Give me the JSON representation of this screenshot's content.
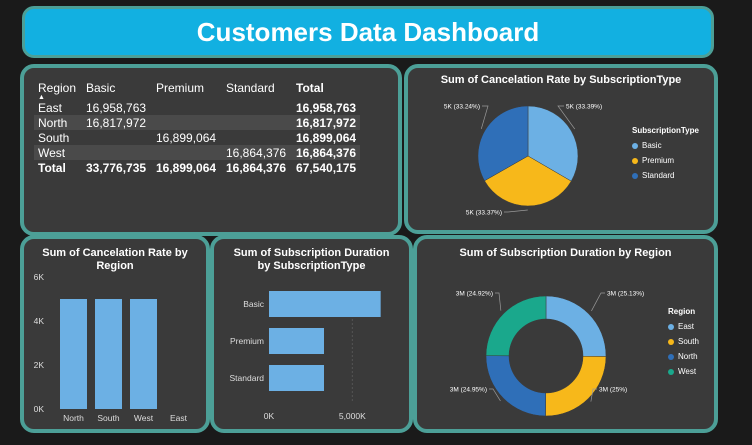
{
  "title": "Customers Data Dashboard",
  "colors": {
    "teal_border": "#4c9f97",
    "banner": "#12b0e1",
    "basic": "#6cb0e4",
    "premium": "#f7b81a",
    "standard": "#2f6fb8",
    "west": "#1aa88c"
  },
  "matrix": {
    "headers": [
      "Region",
      "Basic",
      "Premium",
      "Standard",
      "Total"
    ],
    "rows": [
      {
        "region": "East",
        "basic": "16,958,763",
        "premium": "",
        "standard": "",
        "total": "16,958,763"
      },
      {
        "region": "North",
        "basic": "16,817,972",
        "premium": "",
        "standard": "",
        "total": "16,817,972"
      },
      {
        "region": "South",
        "basic": "",
        "premium": "16,899,064",
        "standard": "",
        "total": "16,899,064"
      },
      {
        "region": "West",
        "basic": "",
        "premium": "",
        "standard": "16,864,376",
        "total": "16,864,376"
      },
      {
        "region": "Total",
        "basic": "33,776,735",
        "premium": "16,899,064",
        "standard": "16,864,376",
        "total": "67,540,175"
      }
    ]
  },
  "chart_data": [
    {
      "type": "pie",
      "title": "Sum of Cancelation Rate by SubscriptionType",
      "legend_title": "SubscriptionType",
      "legend_position": "right",
      "slices": [
        {
          "name": "Basic",
          "label": "5K (33.39%)",
          "percent": 33.39
        },
        {
          "name": "Premium",
          "label": "5K (33.37%)",
          "percent": 33.37
        },
        {
          "name": "Standard",
          "label": "5K (33.24%)",
          "percent": 33.24
        }
      ]
    },
    {
      "type": "bar",
      "title": "Sum of Cancelation Rate by Region",
      "categories": [
        "North",
        "South",
        "West",
        "East"
      ],
      "values": [
        5000,
        5000,
        5000,
        0
      ],
      "yticks": [
        "0K",
        "2K",
        "4K",
        "6K"
      ],
      "ylim": [
        0,
        6000
      ]
    },
    {
      "type": "bar",
      "orientation": "horizontal",
      "title": "Sum of Subscription Duration by SubscriptionType",
      "categories": [
        "Basic",
        "Premium",
        "Standard"
      ],
      "values": [
        6700,
        3300,
        3300
      ],
      "xticks": [
        "0K",
        "5,000K"
      ],
      "xlim": [
        0,
        7500
      ]
    },
    {
      "type": "pie",
      "subtype": "donut",
      "title": "Sum of Subscription Duration by Region",
      "legend_title": "Region",
      "legend_position": "right",
      "slices": [
        {
          "name": "East",
          "label": "3M (25.13%)",
          "percent": 25.13
        },
        {
          "name": "South",
          "label": "3M (25%)",
          "percent": 25.0
        },
        {
          "name": "North",
          "label": "3M (24.95%)",
          "percent": 24.95
        },
        {
          "name": "West",
          "label": "3M (24.92%)",
          "percent": 24.92
        }
      ]
    }
  ]
}
